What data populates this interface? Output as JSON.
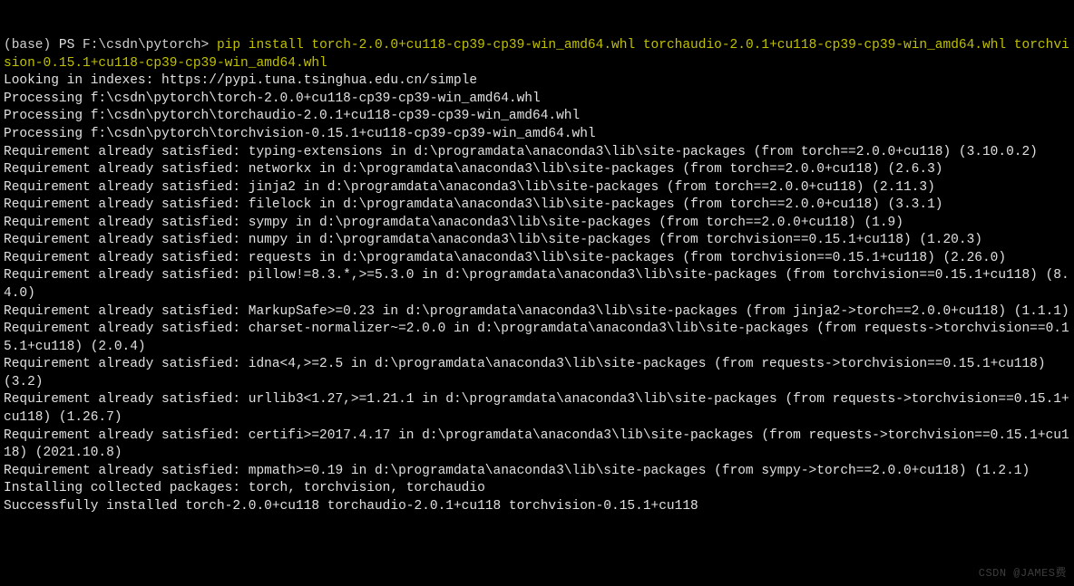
{
  "prompt": {
    "env": "(base)",
    "shell": "PS",
    "path": "F:\\csdn\\pytorch>",
    "command": "pip install torch-2.0.0+cu118-cp39-cp39-win_amd64.whl torchaudio-2.0.1+cu118-cp39-cp39-win_amd64.whl torchvision-0.15.1+cu118-cp39-cp39-win_amd64.whl"
  },
  "lines": [
    "Looking in indexes: https://pypi.tuna.tsinghua.edu.cn/simple",
    "Processing f:\\csdn\\pytorch\\torch-2.0.0+cu118-cp39-cp39-win_amd64.whl",
    "Processing f:\\csdn\\pytorch\\torchaudio-2.0.1+cu118-cp39-cp39-win_amd64.whl",
    "Processing f:\\csdn\\pytorch\\torchvision-0.15.1+cu118-cp39-cp39-win_amd64.whl",
    "Requirement already satisfied: typing-extensions in d:\\programdata\\anaconda3\\lib\\site-packages (from torch==2.0.0+cu118) (3.10.0.2)",
    "Requirement already satisfied: networkx in d:\\programdata\\anaconda3\\lib\\site-packages (from torch==2.0.0+cu118) (2.6.3)",
    "Requirement already satisfied: jinja2 in d:\\programdata\\anaconda3\\lib\\site-packages (from torch==2.0.0+cu118) (2.11.3)",
    "Requirement already satisfied: filelock in d:\\programdata\\anaconda3\\lib\\site-packages (from torch==2.0.0+cu118) (3.3.1)",
    "Requirement already satisfied: sympy in d:\\programdata\\anaconda3\\lib\\site-packages (from torch==2.0.0+cu118) (1.9)",
    "Requirement already satisfied: numpy in d:\\programdata\\anaconda3\\lib\\site-packages (from torchvision==0.15.1+cu118) (1.20.3)",
    "Requirement already satisfied: requests in d:\\programdata\\anaconda3\\lib\\site-packages (from torchvision==0.15.1+cu118) (2.26.0)",
    "Requirement already satisfied: pillow!=8.3.*,>=5.3.0 in d:\\programdata\\anaconda3\\lib\\site-packages (from torchvision==0.15.1+cu118) (8.4.0)",
    "Requirement already satisfied: MarkupSafe>=0.23 in d:\\programdata\\anaconda3\\lib\\site-packages (from jinja2->torch==2.0.0+cu118) (1.1.1)",
    "Requirement already satisfied: charset-normalizer~=2.0.0 in d:\\programdata\\anaconda3\\lib\\site-packages (from requests->torchvision==0.15.1+cu118) (2.0.4)",
    "Requirement already satisfied: idna<4,>=2.5 in d:\\programdata\\anaconda3\\lib\\site-packages (from requests->torchvision==0.15.1+cu118) (3.2)",
    "Requirement already satisfied: urllib3<1.27,>=1.21.1 in d:\\programdata\\anaconda3\\lib\\site-packages (from requests->torchvision==0.15.1+cu118) (1.26.7)",
    "Requirement already satisfied: certifi>=2017.4.17 in d:\\programdata\\anaconda3\\lib\\site-packages (from requests->torchvision==0.15.1+cu118) (2021.10.8)",
    "Requirement already satisfied: mpmath>=0.19 in d:\\programdata\\anaconda3\\lib\\site-packages (from sympy->torch==2.0.0+cu118) (1.2.1)",
    "Installing collected packages: torch, torchvision, torchaudio",
    "Successfully installed torch-2.0.0+cu118 torchaudio-2.0.1+cu118 torchvision-0.15.1+cu118"
  ],
  "watermark": "CSDN @JAMES费"
}
